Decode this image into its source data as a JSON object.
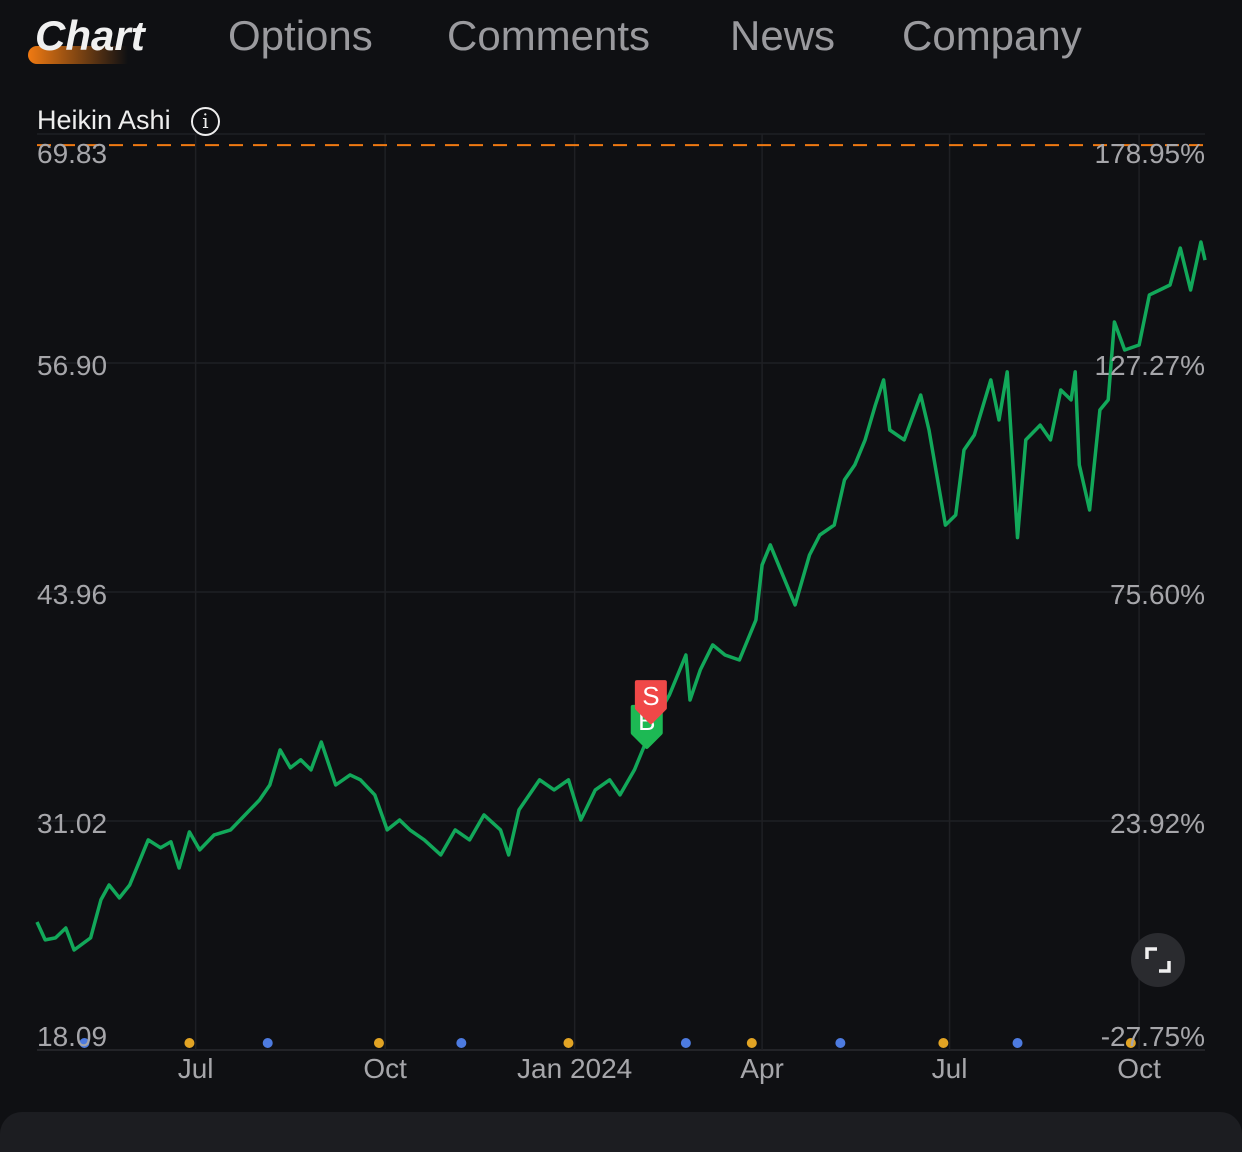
{
  "tabs": [
    {
      "label": "Chart",
      "active": true
    },
    {
      "label": "Options"
    },
    {
      "label": "Comments"
    },
    {
      "label": "News"
    },
    {
      "label": "Company"
    }
  ],
  "indicator": {
    "title": "Heikin Ashi",
    "icon": "info-icon"
  },
  "colors": {
    "line": "#12a85a",
    "accent": "#f07a12",
    "buy": "#1db954",
    "sell": "#f04848",
    "dot_yellow": "#e2a424",
    "dot_blue": "#4d7be0",
    "background": "#0f1013"
  },
  "chart_data": {
    "type": "line",
    "y_ticks_left": [
      "69.83",
      "56.90",
      "43.96",
      "31.02",
      "18.09"
    ],
    "y_ticks_right": [
      "178.95%",
      "127.27%",
      "75.60%",
      "23.92%",
      "-27.75%"
    ],
    "ylim": [
      18.09,
      69.83
    ],
    "x_ticks": [
      {
        "label": "Jul",
        "date": "2023-07-01"
      },
      {
        "label": "Oct",
        "date": "2023-10-01"
      },
      {
        "label": "Jan 2024",
        "date": "2024-01-01"
      },
      {
        "label": "Apr",
        "date": "2024-04-01"
      },
      {
        "label": "Jul",
        "date": "2024-07-01"
      },
      {
        "label": "Oct",
        "date": "2024-10-01"
      }
    ],
    "xlim": [
      "2023-04-15",
      "2024-11-02"
    ],
    "grid": true,
    "reference_line": {
      "value": 69.2,
      "style": "dashed",
      "color": "#f07a12"
    },
    "points": [
      [
        "2023-04-15",
        25.32
      ],
      [
        "2023-04-19",
        24.31
      ],
      [
        "2023-04-24",
        24.42
      ],
      [
        "2023-04-29",
        24.98
      ],
      [
        "2023-05-03",
        23.74
      ],
      [
        "2023-05-11",
        24.42
      ],
      [
        "2023-05-16",
        26.57
      ],
      [
        "2023-05-20",
        27.41
      ],
      [
        "2023-05-25",
        26.68
      ],
      [
        "2023-05-30",
        27.41
      ],
      [
        "2023-06-04",
        28.83
      ],
      [
        "2023-06-08",
        29.96
      ],
      [
        "2023-06-14",
        29.51
      ],
      [
        "2023-06-19",
        29.85
      ],
      [
        "2023-06-23",
        28.37
      ],
      [
        "2023-06-28",
        30.41
      ],
      [
        "2023-07-03",
        29.39
      ],
      [
        "2023-07-10",
        30.24
      ],
      [
        "2023-07-18",
        30.52
      ],
      [
        "2023-07-25",
        31.37
      ],
      [
        "2023-08-01",
        32.21
      ],
      [
        "2023-08-06",
        33.06
      ],
      [
        "2023-08-11",
        35.04
      ],
      [
        "2023-08-16",
        34.03
      ],
      [
        "2023-08-21",
        34.48
      ],
      [
        "2023-08-26",
        33.91
      ],
      [
        "2023-08-31",
        35.49
      ],
      [
        "2023-09-07",
        33.06
      ],
      [
        "2023-09-14",
        33.63
      ],
      [
        "2023-09-19",
        33.35
      ],
      [
        "2023-09-26",
        32.5
      ],
      [
        "2023-10-02",
        30.52
      ],
      [
        "2023-10-08",
        31.08
      ],
      [
        "2023-10-13",
        30.52
      ],
      [
        "2023-10-20",
        29.96
      ],
      [
        "2023-10-28",
        29.11
      ],
      [
        "2023-11-04",
        30.52
      ],
      [
        "2023-11-11",
        29.96
      ],
      [
        "2023-11-18",
        31.37
      ],
      [
        "2023-11-26",
        30.52
      ],
      [
        "2023-11-30",
        29.11
      ],
      [
        "2023-12-05",
        31.65
      ],
      [
        "2023-12-15",
        33.35
      ],
      [
        "2023-12-22",
        32.78
      ],
      [
        "2023-12-29",
        33.35
      ],
      [
        "2024-01-04",
        31.08
      ],
      [
        "2024-01-11",
        32.78
      ],
      [
        "2024-01-18",
        33.35
      ],
      [
        "2024-01-23",
        32.5
      ],
      [
        "2024-01-30",
        33.91
      ],
      [
        "2024-02-04",
        35.32
      ],
      [
        "2024-02-09",
        36.73
      ],
      [
        "2024-02-16",
        38.14
      ],
      [
        "2024-02-24",
        40.4
      ],
      [
        "2024-02-26",
        37.86
      ],
      [
        "2024-03-02",
        39.56
      ],
      [
        "2024-03-08",
        40.97
      ],
      [
        "2024-03-14",
        40.4
      ],
      [
        "2024-03-21",
        40.12
      ],
      [
        "2024-03-29",
        42.38
      ],
      [
        "2024-04-01",
        45.49
      ],
      [
        "2024-04-05",
        46.62
      ],
      [
        "2024-04-10",
        45.21
      ],
      [
        "2024-04-17",
        43.23
      ],
      [
        "2024-04-24",
        46.05
      ],
      [
        "2024-04-29",
        47.18
      ],
      [
        "2024-05-06",
        47.74
      ],
      [
        "2024-05-11",
        50.29
      ],
      [
        "2024-05-16",
        51.14
      ],
      [
        "2024-05-21",
        52.55
      ],
      [
        "2024-05-26",
        54.52
      ],
      [
        "2024-05-30",
        55.94
      ],
      [
        "2024-06-02",
        53.11
      ],
      [
        "2024-06-09",
        52.55
      ],
      [
        "2024-06-17",
        55.09
      ],
      [
        "2024-06-21",
        53.11
      ],
      [
        "2024-06-29",
        47.74
      ],
      [
        "2024-07-04",
        48.31
      ],
      [
        "2024-07-08",
        51.98
      ],
      [
        "2024-07-13",
        52.83
      ],
      [
        "2024-07-21",
        55.94
      ],
      [
        "2024-07-25",
        53.68
      ],
      [
        "2024-07-29",
        56.39
      ],
      [
        "2024-08-03",
        47.03
      ],
      [
        "2024-08-07",
        52.55
      ],
      [
        "2024-08-14",
        53.39
      ],
      [
        "2024-08-19",
        52.55
      ],
      [
        "2024-08-24",
        55.37
      ],
      [
        "2024-08-29",
        54.81
      ],
      [
        "2024-08-31",
        56.39
      ],
      [
        "2024-09-02",
        51.14
      ],
      [
        "2024-09-07",
        48.59
      ],
      [
        "2024-09-12",
        54.24
      ],
      [
        "2024-09-16",
        54.81
      ],
      [
        "2024-09-19",
        59.21
      ],
      [
        "2024-09-24",
        57.63
      ],
      [
        "2024-10-01",
        57.91
      ],
      [
        "2024-10-06",
        60.74
      ],
      [
        "2024-10-11",
        61.02
      ],
      [
        "2024-10-16",
        61.3
      ],
      [
        "2024-10-21",
        63.39
      ],
      [
        "2024-10-26",
        61.02
      ],
      [
        "2024-10-31",
        63.73
      ],
      [
        "2024-11-02",
        62.71
      ]
    ],
    "trade_markers": [
      {
        "label": "B",
        "type": "buy",
        "date": "2024-02-05",
        "value": 36.0
      },
      {
        "label": "S",
        "type": "sell",
        "date": "2024-02-07",
        "value": 37.4
      }
    ],
    "event_dots": {
      "yellow": [
        "2023-06-28",
        "2023-09-28",
        "2023-12-29",
        "2024-03-27",
        "2024-06-28",
        "2024-09-27"
      ],
      "blue": [
        "2023-05-08",
        "2023-08-05",
        "2023-11-07",
        "2024-02-24",
        "2024-05-09",
        "2024-08-03"
      ]
    }
  },
  "controls": {
    "expand_icon": "expand-icon"
  }
}
